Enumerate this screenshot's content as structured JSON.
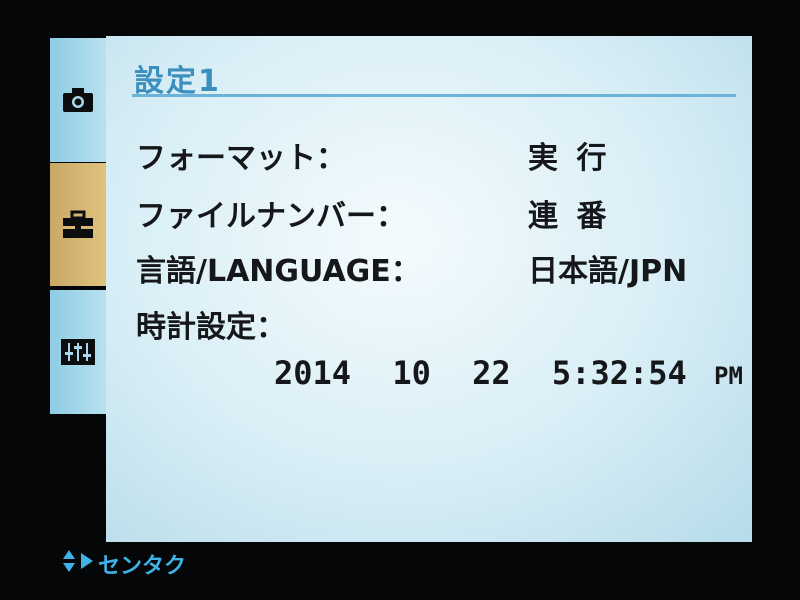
{
  "tabs": [
    {
      "icon": "camera-icon",
      "selected": false
    },
    {
      "icon": "toolbox-icon",
      "selected": true
    },
    {
      "icon": "sliders-icon",
      "selected": false
    }
  ],
  "panel": {
    "title": "設定1",
    "rows": [
      {
        "label": "フォーマット：",
        "value": "実 行"
      },
      {
        "label": "ファイルナンバー：",
        "value": "連 番"
      },
      {
        "label": "言語/LANGUAGE：",
        "value": "日本語/JPN"
      },
      {
        "label": "時計設定："
      }
    ],
    "clock": {
      "year": "2014",
      "month": "10",
      "day": "22",
      "time": "5:32:54",
      "ampm": "PM"
    }
  },
  "hint": {
    "icons": [
      "up-down-arrows-icon",
      "right-arrow-icon"
    ],
    "text": "センタク"
  },
  "colors": {
    "accent": "#3d8fbd",
    "tab_selected": "#d8b874",
    "tab_normal": "#a9d8ec",
    "hint": "#3fb2e6"
  }
}
